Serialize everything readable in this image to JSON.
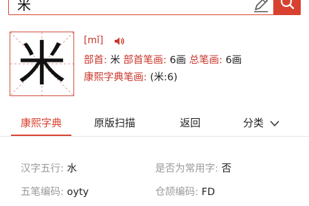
{
  "search": {
    "query": "米"
  },
  "colors": {
    "accent": "#d8412f",
    "label": "#c8372b",
    "muted": "#9a9a9a"
  },
  "icons": {
    "edit": "pencil-icon",
    "search": "search-icon",
    "audio": "speaker-icon",
    "chevron": "chevron-down-icon"
  },
  "character": {
    "glyph": "米",
    "pinyin": "[mǐ]"
  },
  "info": {
    "radical_label": "部首:",
    "radical_value": "米",
    "radical_strokes_label": "部首笔画:",
    "radical_strokes_value": "6画",
    "total_strokes_label": "总笔画:",
    "total_strokes_value": "6画",
    "kangxi_strokes_label": "康熙字典笔画:",
    "kangxi_strokes_value": "(米:6)"
  },
  "tabs": {
    "kangxi": "康熙字典",
    "original_scan": "原版扫描",
    "back": "返回",
    "category": "分类"
  },
  "details": {
    "wuxing_label": "汉字五行:",
    "wuxing_value": "水",
    "common_label": "是否为常用字:",
    "common_value": "否",
    "wubi_label": "五笔编码:",
    "wubi_value": "oyty",
    "cangjie_label": "仓颉编码:",
    "cangjie_value": "FD"
  }
}
